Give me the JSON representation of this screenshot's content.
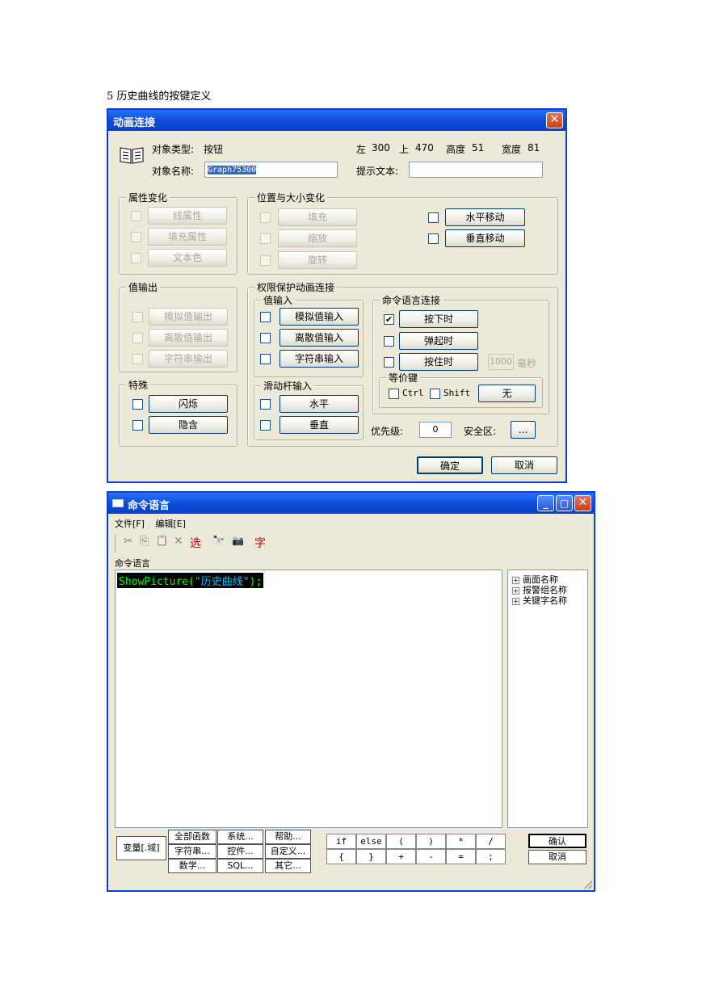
{
  "doc": {
    "heading": "5 历史曲线的按键定义"
  },
  "dialog1": {
    "title": "动画连接",
    "close": "✕",
    "object_type_label": "对象类型:",
    "object_type_value": "按钮",
    "left_label": "左",
    "left_value": "300",
    "top_label": "上",
    "top_value": "470",
    "height_label": "高度",
    "height_value": "51",
    "width_label": "宽度",
    "width_value": "81",
    "object_name_label": "对象名称:",
    "object_name_value": "Graph75300",
    "hint_label": "提示文本:",
    "hint_value": "",
    "attr_group": {
      "title": "属性变化",
      "line": "线属性",
      "fill": "填充属性",
      "text": "文本色"
    },
    "pos_group": {
      "title": "位置与大小变化",
      "fill": "填充",
      "scale": "缩放",
      "rotate": "旋转",
      "hmove": "水平移动",
      "vmove": "垂直移动"
    },
    "out_group": {
      "title": "值输出",
      "analog": "模拟值输出",
      "discrete": "离散值输出",
      "string": "字符串输出"
    },
    "perm_group": {
      "title": "权限保护动画连接"
    },
    "in_group": {
      "title": "值输入",
      "analog": "模拟值输入",
      "discrete": "离散值输入",
      "string": "字符串输入"
    },
    "cmd_group": {
      "title": "命令语言连接",
      "press": "按下时",
      "release": "弹起时",
      "hold": "按住时",
      "hold_ms": "1000",
      "ms_unit": "毫秒",
      "press_check": "✔"
    },
    "equiv_group": {
      "title": "等价键",
      "ctrl": "Ctrl",
      "shift": "Shift",
      "key": "无"
    },
    "special_group": {
      "title": "特殊",
      "blink": "闪烁",
      "hide": "隐含"
    },
    "slider_group": {
      "title": "滑动杆输入",
      "h": "水平",
      "v": "垂直"
    },
    "priority_label": "优先级:",
    "priority_value": "0",
    "safety_label": "安全区:",
    "safety_btn": "...",
    "ok": "确定",
    "cancel": "取消"
  },
  "dialog2": {
    "title": "命令语言",
    "min": "_",
    "max": "□",
    "close": "✕",
    "menu": [
      "文件[F]",
      "编辑[E]"
    ],
    "toolbar": [
      "✂",
      "⎘",
      "📋",
      "✕",
      "选",
      "🔭",
      "📷",
      "字"
    ],
    "editor_label": "命令语言",
    "code_fn": "ShowPicture(",
    "code_str": "\"历史曲线\"",
    "code_end": ");",
    "tree": [
      "画面名称",
      "报警组名称",
      "关键字名称"
    ],
    "var_btn": "变量[.域]",
    "func_btns": [
      "全部函数",
      "系统...",
      "帮助...",
      "字符串...",
      "控件...",
      "自定义...",
      "数学...",
      "SQL...",
      "其它..."
    ],
    "ops": [
      "if",
      "else",
      "(",
      ")",
      "*",
      "/",
      "{",
      "}",
      "+",
      "-",
      "=",
      ";"
    ],
    "ok": "确认",
    "cancel": "取消"
  }
}
